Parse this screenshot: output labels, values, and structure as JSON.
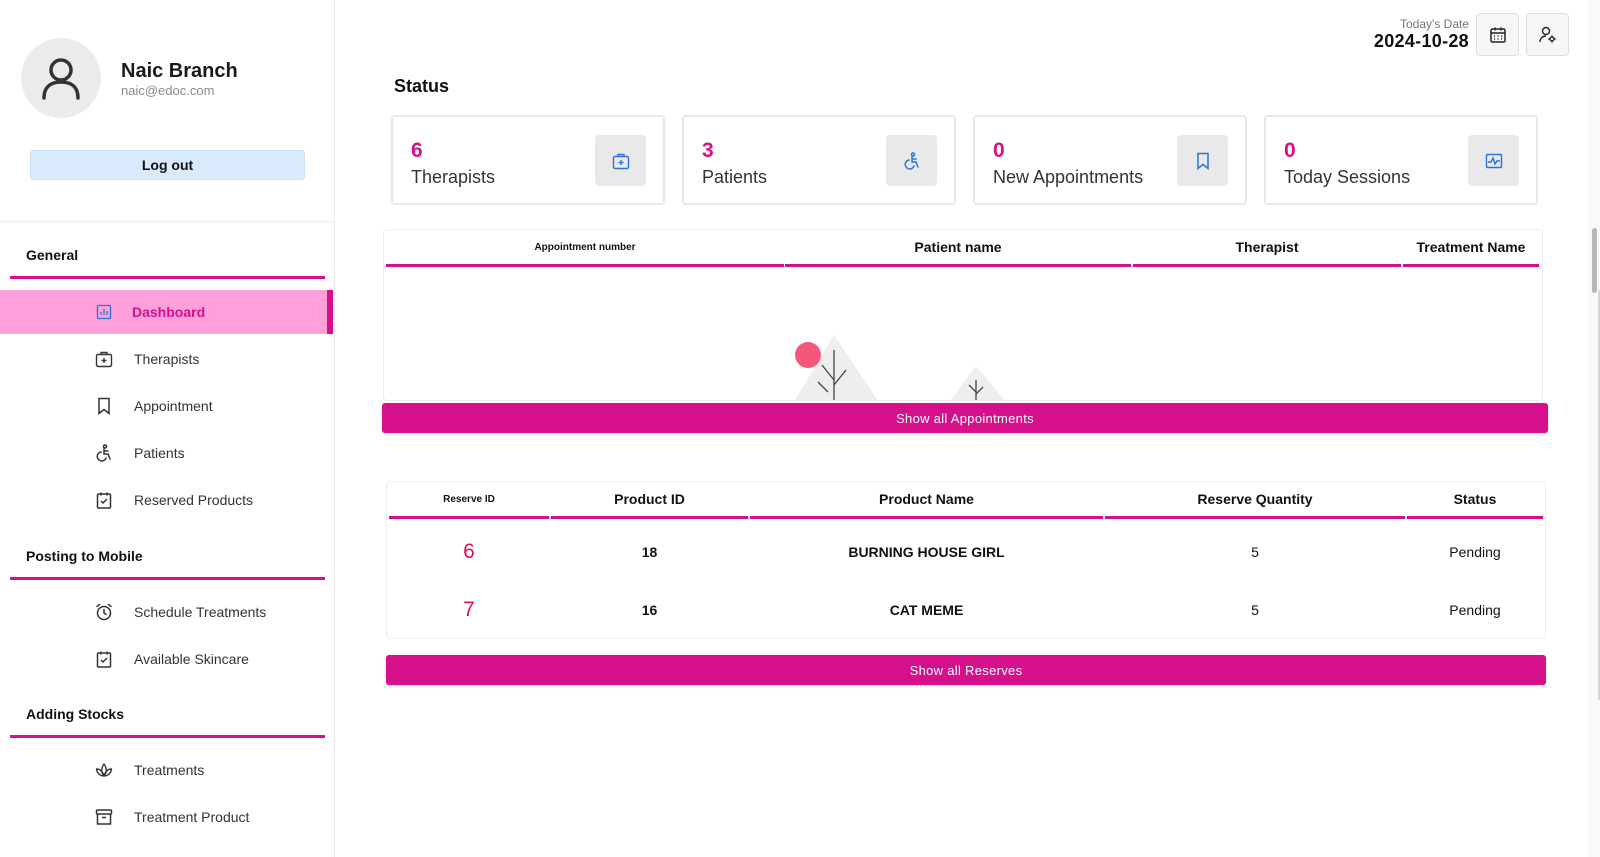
{
  "profile": {
    "name": "Naic Branch",
    "email": "naic@edoc.com",
    "logout_label": "Log out"
  },
  "sidebar": {
    "sections": [
      {
        "title": "General"
      },
      {
        "title": "Posting to Mobile"
      },
      {
        "title": "Adding Stocks"
      }
    ],
    "items": [
      {
        "label": "Dashboard",
        "icon": "dashboard-icon",
        "active": true
      },
      {
        "label": "Therapists",
        "icon": "medical-kit-icon"
      },
      {
        "label": "Appointment",
        "icon": "bookmark-icon"
      },
      {
        "label": "Patients",
        "icon": "wheelchair-icon"
      },
      {
        "label": "Reserved Products",
        "icon": "clipboard-check-icon"
      },
      {
        "label": "Schedule Treatments",
        "icon": "alarm-clock-icon"
      },
      {
        "label": "Available Skincare",
        "icon": "clipboard-check-icon"
      },
      {
        "label": "Treatments",
        "icon": "lotus-icon"
      },
      {
        "label": "Treatment Product",
        "icon": "archive-box-icon"
      }
    ]
  },
  "header": {
    "date_label": "Today's Date",
    "date_value": "2024-10-28"
  },
  "status": {
    "title": "Status",
    "cards": [
      {
        "value": "6",
        "label": "Therapists",
        "icon": "medical-kit-icon"
      },
      {
        "value": "3",
        "label": "Patients",
        "icon": "wheelchair-icon"
      },
      {
        "value": "0",
        "label": "New Appointments",
        "icon": "bookmark-icon"
      },
      {
        "value": "0",
        "label": "Today Sessions",
        "icon": "pulse-monitor-icon"
      }
    ]
  },
  "appointments": {
    "columns": [
      "Appointment number",
      "Patient name",
      "Therapist",
      "Treatment Name"
    ],
    "show_all_label": "Show all Appointments"
  },
  "reserves": {
    "columns": [
      "Reserve ID",
      "Product ID",
      "Product Name",
      "Reserve Quantity",
      "Status"
    ],
    "rows": [
      {
        "reserve_id": "6",
        "product_id": "18",
        "product_name": "BURNING HOUSE GIRL",
        "quantity": "5",
        "status": "Pending"
      },
      {
        "reserve_id": "7",
        "product_id": "16",
        "product_name": "CAT MEME",
        "quantity": "5",
        "status": "Pending"
      }
    ],
    "show_all_label": "Show all Reserves"
  },
  "colors": {
    "accent": "#d6108a",
    "active_bg": "#ff9fdc",
    "logout_bg": "#d9ebfa",
    "icon_blue": "#2b74d6"
  }
}
